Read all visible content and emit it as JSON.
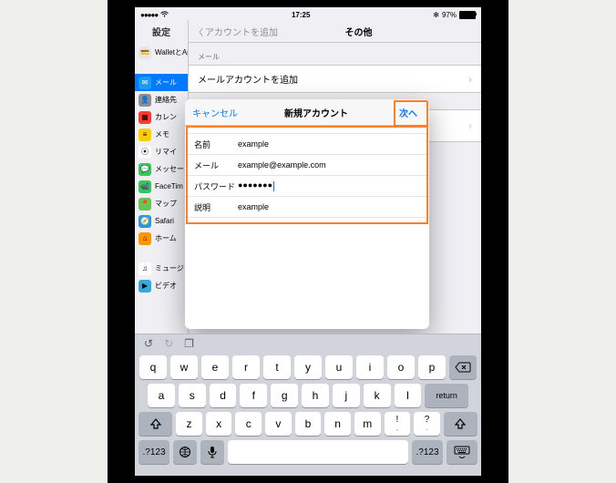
{
  "status": {
    "signal_dots": "●●●●●",
    "time": "17:25",
    "bt": "✻",
    "battery_pct": "97%"
  },
  "sidebar": {
    "title": "設定",
    "items": [
      {
        "label": "WalletとApple Pay",
        "icon_bg": "#e5e5ea",
        "icon_glyph": "💳"
      },
      {
        "label": "メール",
        "icon_bg": "#1d9bf0",
        "icon_glyph": "✉",
        "selected": true
      },
      {
        "label": "連絡先",
        "icon_bg": "#8e8e93",
        "icon_glyph": "👤"
      },
      {
        "label": "カレン",
        "icon_bg": "#ff3b30",
        "icon_glyph": "▦"
      },
      {
        "label": "メモ",
        "icon_bg": "#ffcc00",
        "icon_glyph": "≡"
      },
      {
        "label": "リマイ",
        "icon_bg": "#ffffff",
        "icon_glyph": "⦿"
      },
      {
        "label": "メッセー",
        "icon_bg": "#34c759",
        "icon_glyph": "💬"
      },
      {
        "label": "FaceTim",
        "icon_bg": "#34c759",
        "icon_glyph": "📹"
      },
      {
        "label": "マップ",
        "icon_bg": "#68c650",
        "icon_glyph": "📍"
      },
      {
        "label": "Safari",
        "icon_bg": "#1d9bf0",
        "icon_glyph": "🧭"
      },
      {
        "label": "ホーム",
        "icon_bg": "#ff9500",
        "icon_glyph": "⌂"
      },
      {
        "label": "ミュージ",
        "icon_bg": "#ffffff",
        "icon_glyph": "♫"
      },
      {
        "label": "ビデオ",
        "icon_bg": "#34aadc",
        "icon_glyph": "▶"
      }
    ]
  },
  "content": {
    "back": "アカウントを追加",
    "title": "その他",
    "section_mail": "メール",
    "add_mail_account": "メールアカウントを追加"
  },
  "modal": {
    "cancel": "キャンセル",
    "title": "新規アカウント",
    "next": "次へ",
    "fields": {
      "name_label": "名前",
      "name_value": "example",
      "mail_label": "メール",
      "mail_value": "example@example.com",
      "password_label": "パスワード",
      "password_value": "●●●●●●●",
      "desc_label": "説明",
      "desc_value": "example"
    }
  },
  "keyboard": {
    "row1": [
      "q",
      "w",
      "e",
      "r",
      "t",
      "y",
      "u",
      "i",
      "o",
      "p"
    ],
    "row2": [
      "a",
      "s",
      "d",
      "f",
      "g",
      "h",
      "j",
      "k",
      "l"
    ],
    "row3": [
      "z",
      "x",
      "c",
      "v",
      "b",
      "n",
      "m",
      "!\n,",
      "?\n."
    ],
    "return": "return",
    "numkey": ".?123",
    "space": " "
  }
}
